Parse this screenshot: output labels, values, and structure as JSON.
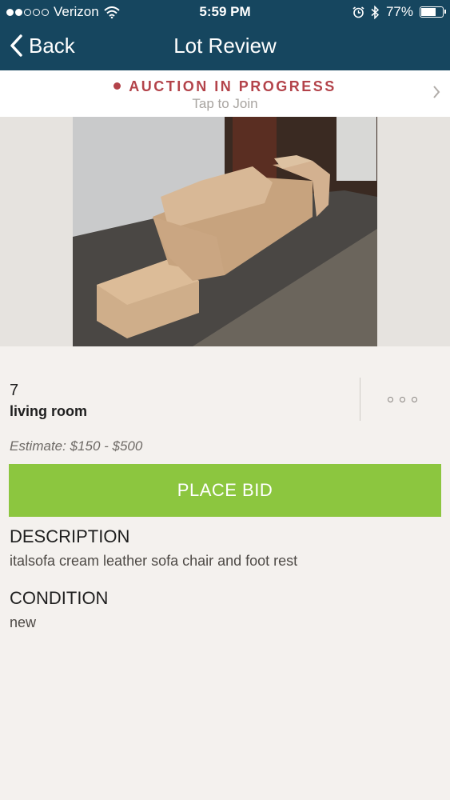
{
  "status_bar": {
    "carrier": "Verizon",
    "time": "5:59 PM",
    "battery": "77%",
    "battery_level": 0.77,
    "signal_bars_filled": 2,
    "signal_bars_total": 5
  },
  "nav": {
    "back_label": "Back",
    "title": "Lot Review"
  },
  "auction_banner": {
    "status": "AUCTION IN PROGRESS",
    "action": "Tap to Join"
  },
  "lot": {
    "number": "7",
    "title": "living room",
    "estimate": "Estimate: $150 - $500"
  },
  "bid_button_label": "PLACE BID",
  "description": {
    "heading": "DESCRIPTION",
    "text": "italsofa cream leather sofa chair and foot rest"
  },
  "condition": {
    "heading": "CONDITION",
    "text": "new"
  },
  "colors": {
    "header": "#16465f",
    "accent_red": "#b3434a",
    "bid_green": "#8cc63f",
    "background": "#f4f1ee"
  }
}
